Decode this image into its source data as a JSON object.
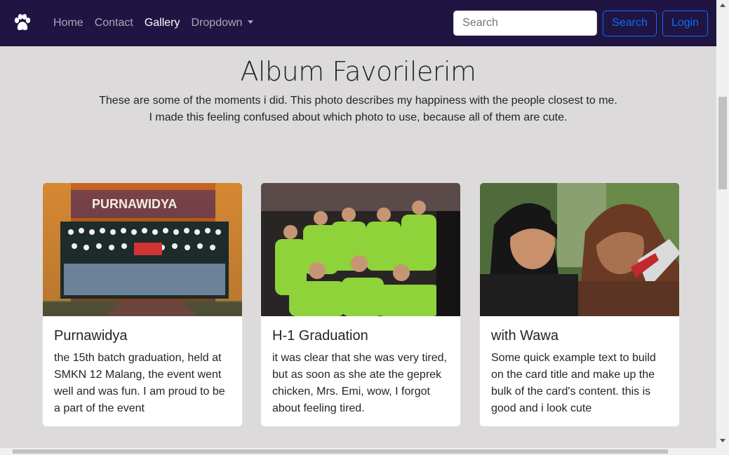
{
  "navbar": {
    "brand_icon": "paw-icon",
    "links": [
      {
        "label": "Home",
        "active": false
      },
      {
        "label": "Contact",
        "active": false
      },
      {
        "label": "Gallery",
        "active": true
      },
      {
        "label": "Dropdown",
        "active": false
      }
    ],
    "search": {
      "placeholder": "Search",
      "value": ""
    },
    "search_button": "Search",
    "login_button": "Login",
    "colors": {
      "background": "#1f1442",
      "accent": "#0d6efd"
    }
  },
  "header": {
    "title": "Album Favorilerim",
    "lead_line1": "These are some of the moments i did. This photo describes my happiness with the people closest to me.",
    "lead_line2": "I made this feeling confused about which photo to use, because all of them are cute."
  },
  "cards": [
    {
      "title": "Purnawidya",
      "text": "the 15th batch graduation, held at SMKN 12 Malang, the event went well and was fun. I am proud to be a part of the event",
      "banner_text": "PURNAWIDYA"
    },
    {
      "title": "H-1 Graduation",
      "text": "it was clear that she was very tired, but as soon as she ate the geprek chicken, Mrs. Emi, wow, I forgot about feeling tired."
    },
    {
      "title": "with Wawa",
      "text": "Some quick example text to build on the card title and make up the bulk of the card's content. this is good and i look cute"
    }
  ]
}
